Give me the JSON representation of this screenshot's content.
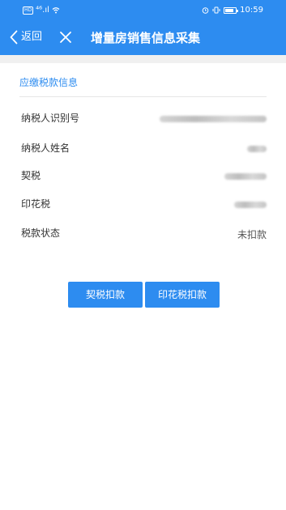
{
  "status_bar": {
    "hd": "HD",
    "network": "⁴⁶.ıl",
    "time": "10:59"
  },
  "nav": {
    "back_label": "返回",
    "title": "增量房销售信息采集"
  },
  "section": {
    "title": "应缴税款信息"
  },
  "rows": [
    {
      "label": "纳税人识别号",
      "value": ""
    },
    {
      "label": "纳税人姓名",
      "value": ""
    },
    {
      "label": "契税",
      "value": ""
    },
    {
      "label": "印花税",
      "value": ""
    },
    {
      "label": "税款状态",
      "value": "未扣款"
    }
  ],
  "buttons": {
    "deed_tax": "契税扣款",
    "stamp_tax": "印花税扣款"
  },
  "colors": {
    "primary": "#2d8cf0",
    "background": "#ffffff"
  }
}
